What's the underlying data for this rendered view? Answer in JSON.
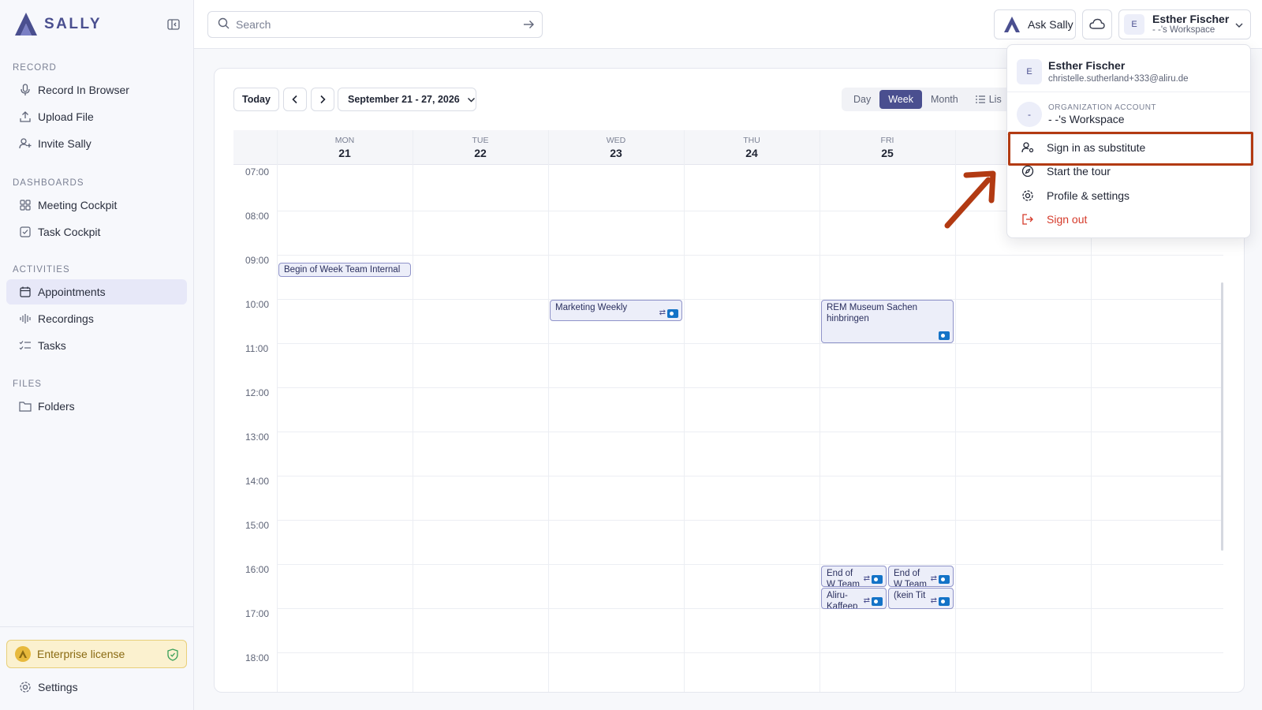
{
  "app": {
    "name": "SALLY"
  },
  "sidebar": {
    "sections": {
      "record": "RECORD",
      "dashboards": "DASHBOARDS",
      "activities": "ACTIVITIES",
      "files": "FILES"
    },
    "items": {
      "record_in_browser": "Record In Browser",
      "upload_file": "Upload File",
      "invite_sally": "Invite Sally",
      "meeting_cockpit": "Meeting Cockpit",
      "task_cockpit": "Task Cockpit",
      "appointments": "Appointments",
      "recordings": "Recordings",
      "tasks": "Tasks",
      "folders": "Folders"
    },
    "license": "Enterprise license",
    "settings": "Settings",
    "active_item": "appointments"
  },
  "topbar": {
    "search_placeholder": "Search",
    "ask_label": "Ask Sally",
    "user_initial": "E",
    "user_name": "Esther Fischer",
    "workspace": "- -'s Workspace"
  },
  "calendar": {
    "today_label": "Today",
    "range_label": "September 21 - 27, 2026",
    "views": {
      "day": "Day",
      "week": "Week",
      "month": "Month",
      "list": "Lis"
    },
    "active_view": "Week",
    "days": [
      {
        "name": "MON",
        "date": "21"
      },
      {
        "name": "TUE",
        "date": "22"
      },
      {
        "name": "WED",
        "date": "23"
      },
      {
        "name": "THU",
        "date": "24"
      },
      {
        "name": "FRI",
        "date": "25"
      }
    ],
    "hours": [
      "07:00",
      "08:00",
      "09:00",
      "10:00",
      "11:00",
      "12:00",
      "13:00",
      "14:00",
      "15:00",
      "16:00",
      "17:00",
      "18:00"
    ],
    "events": {
      "mon_begin": "Begin of Week Team Internal",
      "wed_marketing": "Marketing Weekly",
      "fri_rem": "REM Museum Sachen hinbringen",
      "fri_end1": "End of W Team",
      "fri_end2": "End of W Team",
      "fri_aliru": "Aliru-Kaffeep",
      "fri_kein": "(kein Tit"
    }
  },
  "dropdown": {
    "user_initial": "E",
    "user_name": "Esther Fischer",
    "email": "christelle.sutherland+333@aliru.de",
    "org_initial": "-",
    "org_label": "ORGANIZATION ACCOUNT",
    "org_workspace": "- -'s Workspace",
    "items": {
      "substitute": "Sign in as substitute",
      "tour": "Start the tour",
      "profile": "Profile & settings",
      "signout": "Sign out"
    }
  },
  "colors": {
    "brand": "#4a4f8f",
    "highlight": "#b23a12",
    "danger": "#d53a2a",
    "license": "#e7b93c"
  }
}
